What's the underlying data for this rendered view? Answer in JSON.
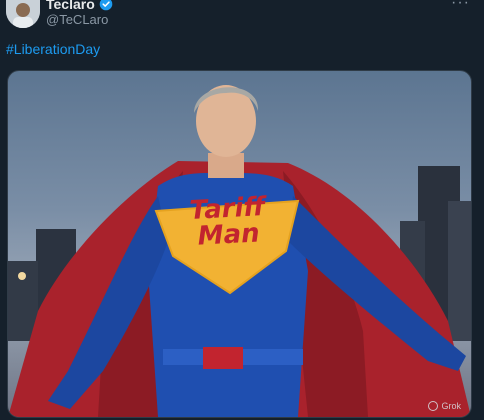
{
  "post": {
    "display_name": "Teclaro",
    "handle": "@TeCLaro",
    "hashtag": "#LiberationDay",
    "more_label": "···",
    "verified_color": "#1d9bf0"
  },
  "media": {
    "emblem_line1": "Tariff",
    "emblem_line2": "Man",
    "watermark": "Grok"
  },
  "colors": {
    "background": "#15202b",
    "link": "#1d9bf0",
    "cape": "#b0232c",
    "suit": "#1f4fb0",
    "emblem": "#f2b233"
  }
}
